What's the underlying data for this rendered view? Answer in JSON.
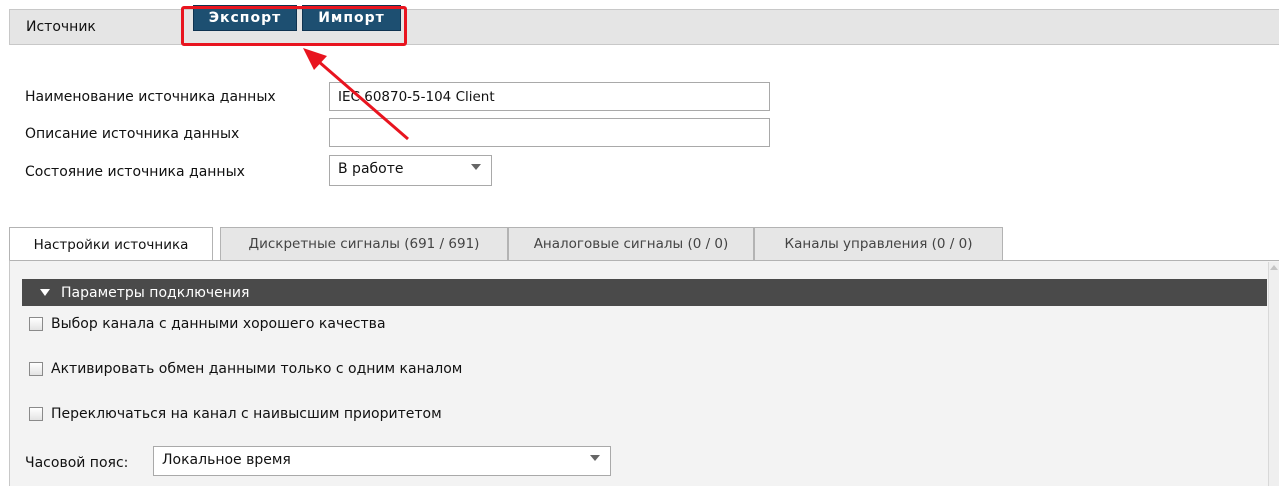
{
  "header": {
    "title": "Источник",
    "export_label": "Экспорт",
    "import_label": "Импорт"
  },
  "form": {
    "name_label": "Наименование источника данных",
    "name_value": "IEC 60870-5-104 Client",
    "description_label": "Описание источника данных",
    "description_value": "",
    "state_label": "Состояние источника данных",
    "state_value": "В работе"
  },
  "tabs": [
    {
      "label": "Настройки источника",
      "active": true
    },
    {
      "label": "Дискретные сигналы (691 / 691)",
      "active": false
    },
    {
      "label": "Аналоговые сигналы (0 / 0)",
      "active": false
    },
    {
      "label": "Каналы управления (0 / 0)",
      "active": false
    }
  ],
  "section": {
    "title": "Параметры подключения",
    "options": [
      {
        "label": "Выбор канала с данными хорошего качества",
        "checked": false
      },
      {
        "label": "Активировать обмен данными только с одним каналом",
        "checked": false
      },
      {
        "label": "Переключаться на канал с наивысшим приоритетом",
        "checked": false
      }
    ],
    "timezone_label": "Часовой пояс:",
    "timezone_value": "Локальное время"
  },
  "colors": {
    "button_bg": "#1d4f71",
    "highlight": "#e8141f",
    "section_header_bg": "#4a4a4a"
  }
}
